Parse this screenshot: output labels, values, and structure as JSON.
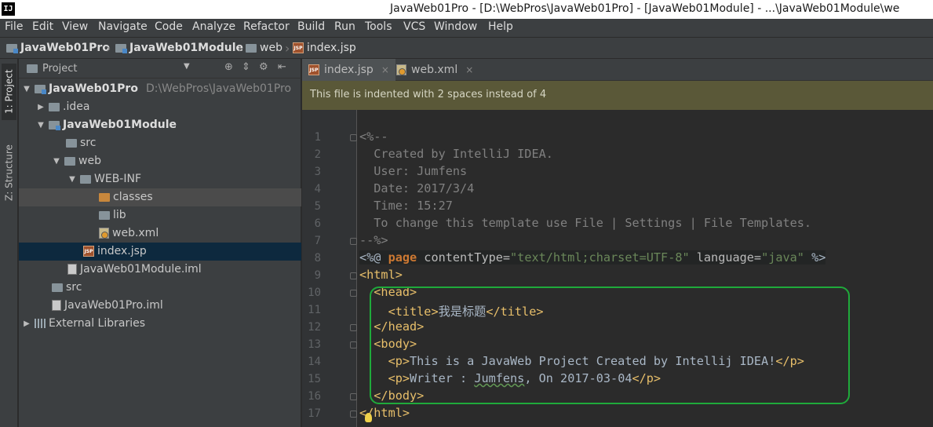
{
  "window": {
    "logo": "IJ",
    "title": "JavaWeb01Pro - [D:\\WebPros\\JavaWeb01Pro] - [JavaWeb01Module] - ...\\JavaWeb01Module\\we"
  },
  "menu": [
    "File",
    "Edit",
    "View",
    "Navigate",
    "Code",
    "Analyze",
    "Refactor",
    "Build",
    "Run",
    "Tools",
    "VCS",
    "Window",
    "Help"
  ],
  "breadcrumbs": [
    "JavaWeb01Pro",
    "JavaWeb01Module",
    "web",
    "index.jsp"
  ],
  "left_tool_tabs": [
    "1: Project",
    "Z: Structure"
  ],
  "project_panel": {
    "title": "Project",
    "tree": [
      {
        "label": "JavaWeb01Pro",
        "path": "D:\\WebPros\\JavaWeb01Pro",
        "expanded": true
      },
      {
        "label": ".idea",
        "expanded": false
      },
      {
        "label": "JavaWeb01Module",
        "expanded": true
      },
      {
        "label": "src"
      },
      {
        "label": "web",
        "expanded": true
      },
      {
        "label": "WEB-INF",
        "expanded": true
      },
      {
        "label": "classes"
      },
      {
        "label": "lib"
      },
      {
        "label": "web.xml"
      },
      {
        "label": "index.jsp",
        "selected": true
      },
      {
        "label": "JavaWeb01Module.iml"
      },
      {
        "label": "src"
      },
      {
        "label": "JavaWeb01Pro.iml"
      },
      {
        "label": "External Libraries",
        "expanded": false
      }
    ]
  },
  "editor": {
    "tabs": [
      {
        "label": "index.jsp",
        "active": true
      },
      {
        "label": "web.xml",
        "active": false
      }
    ],
    "banner": "This file is indented with 2 spaces instead of 4",
    "line_numbers": [
      "1",
      "2",
      "3",
      "4",
      "5",
      "6",
      "7",
      "8",
      "9",
      "10",
      "11",
      "12",
      "13",
      "14",
      "15",
      "16",
      "17"
    ],
    "code": {
      "l1": "<%--",
      "l2": "  Created by IntelliJ IDEA.",
      "l3": "  User: Jumfens",
      "l4": "  Date: 2017/3/4",
      "l5": "  Time: 15:27",
      "l6": "  To change this template use File | Settings | File Templates.",
      "l7": "--%>",
      "l8": {
        "open": "<%@ ",
        "kw": "page",
        "a1": " contentType=",
        "v1": "\"text/html;charset=UTF-8\"",
        "a2": " language=",
        "v2": "\"java\"",
        "close": " %>"
      },
      "l9": "<html>",
      "l10": "  <head>",
      "l11": {
        "indent": "    ",
        "open": "<title>",
        "text": "我是标题",
        "close": "</title>"
      },
      "l12": "  </head>",
      "l13": "  <body>",
      "l14": {
        "indent": "    ",
        "open": "<p>",
        "text": "This is a JavaWeb Project Created by Intellij IDEA!",
        "close": "</p>"
      },
      "l15": {
        "indent": "    ",
        "open": "<p>",
        "t1": "Writer : ",
        "name": "Jumfens",
        "t2": ", On 2017-03-04",
        "close": "</p>"
      },
      "l16": "  </body>",
      "l17": "</html>"
    }
  },
  "colors": {
    "highlight_box": "#1faa3b",
    "banner_bg": "#5a5838",
    "selection": "#0d293e"
  }
}
